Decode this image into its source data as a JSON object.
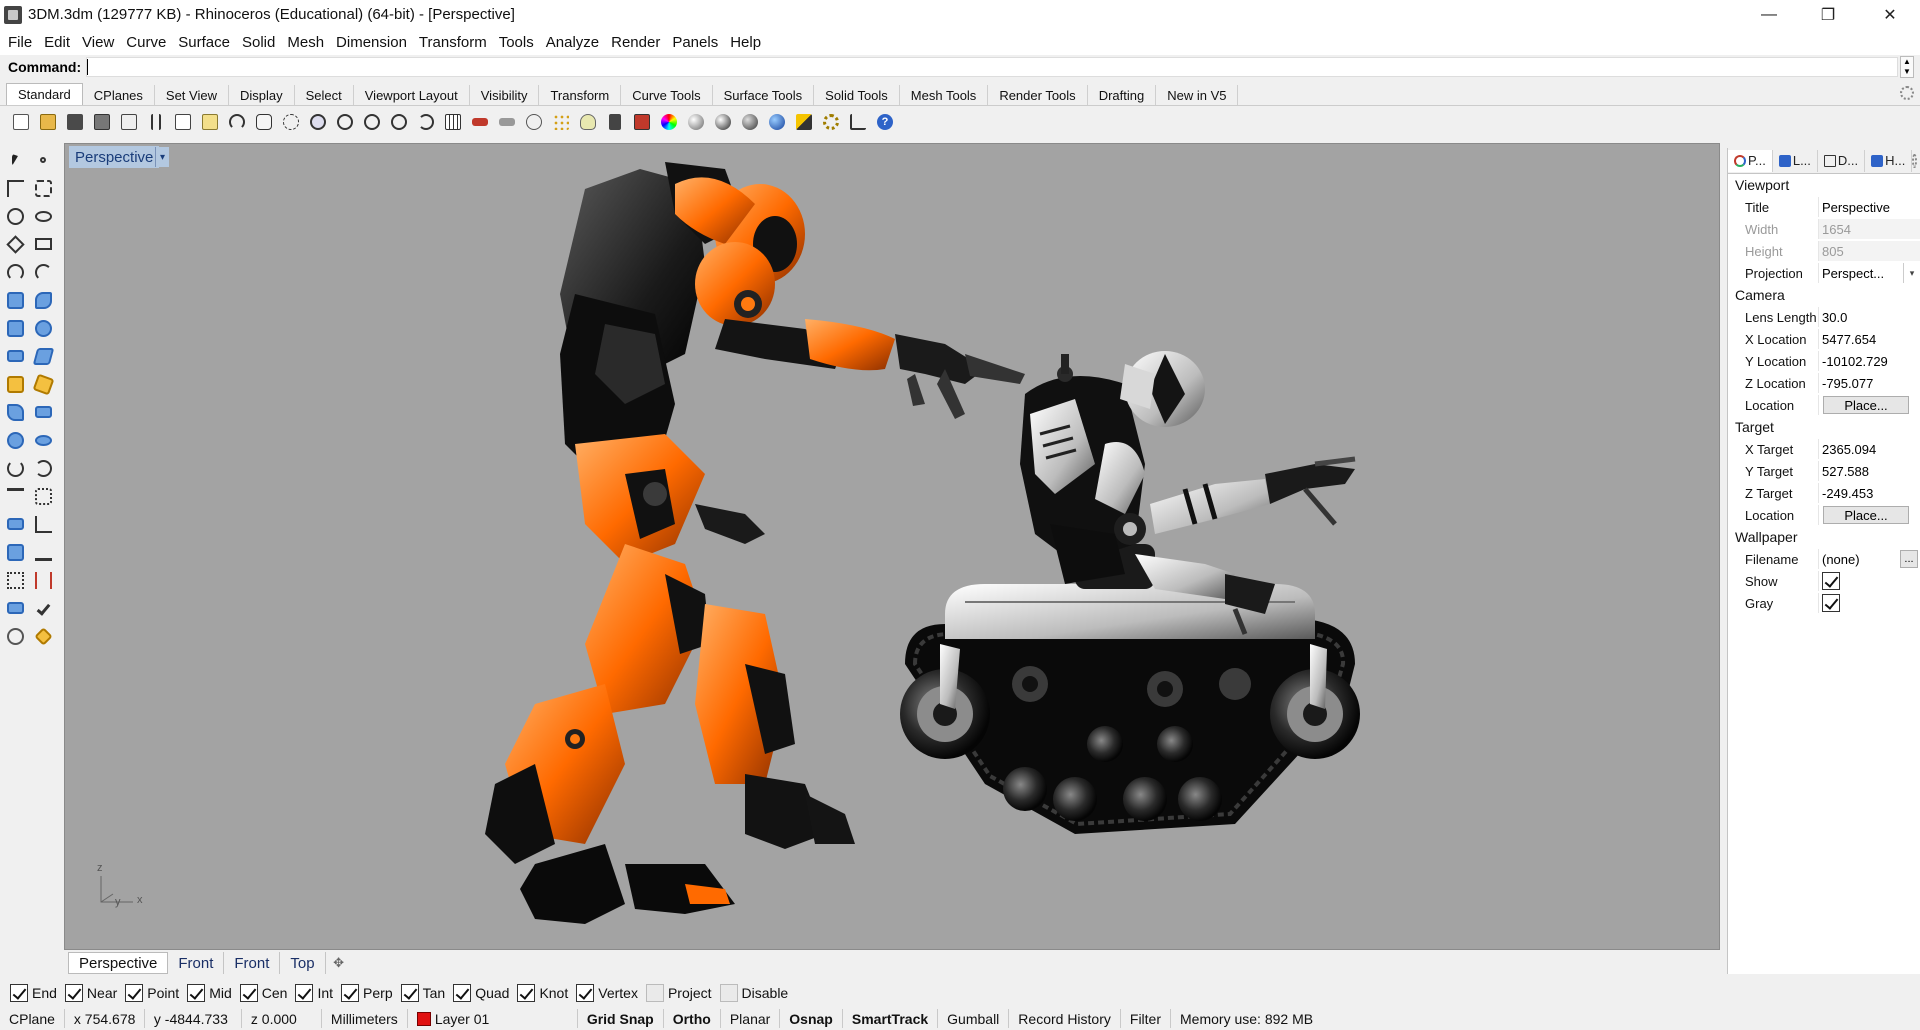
{
  "window": {
    "title": "3DM.3dm (129777 KB) - Rhinoceros (Educational) (64-bit) - [Perspective]",
    "minimize": "—",
    "restore": "❐",
    "close": "✕"
  },
  "menu": [
    "File",
    "Edit",
    "View",
    "Curve",
    "Surface",
    "Solid",
    "Mesh",
    "Dimension",
    "Transform",
    "Tools",
    "Analyze",
    "Render",
    "Panels",
    "Help"
  ],
  "command": {
    "label": "Command:",
    "value": ""
  },
  "toolbar_tabs": [
    "Standard",
    "CPlanes",
    "Set View",
    "Display",
    "Select",
    "Viewport Layout",
    "Visibility",
    "Transform",
    "Curve Tools",
    "Surface Tools",
    "Solid Tools",
    "Mesh Tools",
    "Render Tools",
    "Drafting",
    "New in V5"
  ],
  "viewport": {
    "title": "Perspective",
    "dropdown": "▾",
    "axes": {
      "z": "z",
      "y": "y",
      "x": "x"
    }
  },
  "viewport_tabs": [
    "Perspective",
    "Front",
    "Front",
    "Top"
  ],
  "viewport_tab_add": "✥",
  "osnaps": [
    {
      "label": "End",
      "checked": true
    },
    {
      "label": "Near",
      "checked": true
    },
    {
      "label": "Point",
      "checked": true
    },
    {
      "label": "Mid",
      "checked": true
    },
    {
      "label": "Cen",
      "checked": true
    },
    {
      "label": "Int",
      "checked": true
    },
    {
      "label": "Perp",
      "checked": true
    },
    {
      "label": "Tan",
      "checked": true
    },
    {
      "label": "Quad",
      "checked": true
    },
    {
      "label": "Knot",
      "checked": true
    },
    {
      "label": "Vertex",
      "checked": true
    },
    {
      "label": "Project",
      "checked": false
    },
    {
      "label": "Disable",
      "checked": false
    }
  ],
  "status": {
    "cplane": "CPlane",
    "x": "x 754.678",
    "y": "y -4844.733",
    "z": "z 0.000",
    "units": "Millimeters",
    "layer": "Layer 01",
    "layer_color": "#e01010",
    "toggles": [
      {
        "label": "Grid Snap",
        "bold": true
      },
      {
        "label": "Ortho",
        "bold": true
      },
      {
        "label": "Planar",
        "bold": false
      },
      {
        "label": "Osnap",
        "bold": true
      },
      {
        "label": "SmartTrack",
        "bold": true
      },
      {
        "label": "Gumball",
        "bold": false
      },
      {
        "label": "Record History",
        "bold": false
      },
      {
        "label": "Filter",
        "bold": false
      }
    ],
    "memory": "Memory use: 892 MB"
  },
  "panel": {
    "tabs": [
      {
        "label": "P...",
        "icon": "properties-icon"
      },
      {
        "label": "L...",
        "icon": "layers-icon"
      },
      {
        "label": "D...",
        "icon": "display-icon"
      },
      {
        "label": "H...",
        "icon": "help-icon"
      }
    ],
    "viewport_section": "Viewport",
    "title_label": "Title",
    "title_value": "Perspective",
    "width_label": "Width",
    "width_value": "1654",
    "height_label": "Height",
    "height_value": "805",
    "projection_label": "Projection",
    "projection_value": "Perspect...",
    "camera_section": "Camera",
    "lens_label": "Lens Length",
    "lens_value": "30.0",
    "xloc_label": "X Location",
    "xloc_value": "5477.654",
    "yloc_label": "Y Location",
    "yloc_value": "-10102.729",
    "zloc_label": "Z Location",
    "zloc_value": "-795.077",
    "cam_location_label": "Location",
    "cam_place_button": "Place...",
    "target_section": "Target",
    "xt_label": "X Target",
    "xt_value": "2365.094",
    "yt_label": "Y Target",
    "yt_value": "527.588",
    "zt_label": "Z Target",
    "zt_value": "-249.453",
    "tgt_location_label": "Location",
    "tgt_place_button": "Place...",
    "wallpaper_section": "Wallpaper",
    "filename_label": "Filename",
    "filename_value": "(none)",
    "filename_button": "...",
    "show_label": "Show",
    "show_checked": true,
    "gray_label": "Gray",
    "gray_checked": true
  }
}
